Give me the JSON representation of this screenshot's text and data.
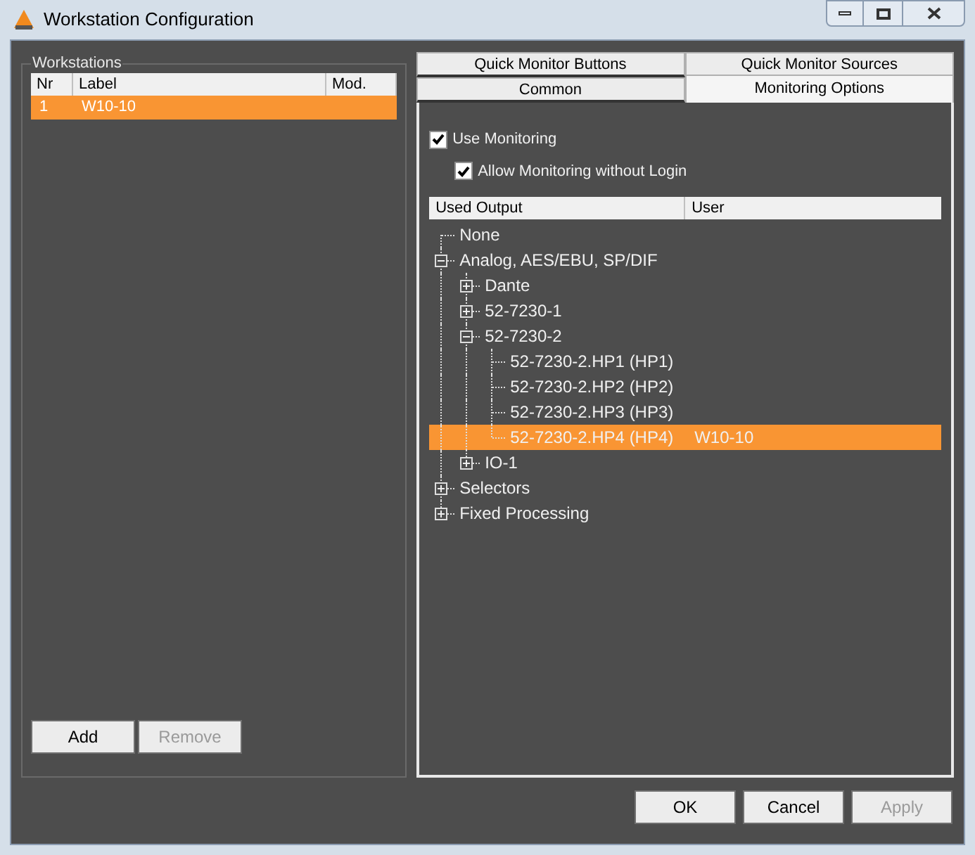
{
  "window": {
    "title": "Workstation Configuration"
  },
  "workstations": {
    "title": "Workstations",
    "columns": [
      "Nr",
      "Label",
      "Mod."
    ],
    "rows": [
      {
        "cells": [
          "1",
          "W10-10",
          ""
        ],
        "selected": true
      }
    ],
    "buttons": [
      {
        "label": "Add",
        "disabled": false
      },
      {
        "label": "Remove",
        "disabled": true
      }
    ]
  },
  "tab_rows": [
    [
      {
        "label": "Quick Monitor Buttons",
        "selected": false
      },
      {
        "label": "Quick Monitor Sources",
        "selected": false
      }
    ],
    [
      {
        "label": "Common",
        "selected": false
      },
      {
        "label": "Monitoring Options",
        "selected": true
      }
    ]
  ],
  "options": [
    {
      "label": "Use Monitoring",
      "checked": true,
      "children": [
        {
          "label": "Allow Monitoring without Login",
          "checked": true
        }
      ]
    }
  ],
  "outputs": {
    "columns": [
      "Used Output",
      "User"
    ],
    "tree": [
      {
        "label": "None",
        "selected": false
      },
      {
        "label": "Analog, AES/EBU, SP/DIF",
        "selected": false,
        "expanded": true,
        "children": [
          {
            "label": "Dante",
            "selected": false,
            "expanded": false
          },
          {
            "label": "52-7230-1",
            "selected": false,
            "expanded": false
          },
          {
            "label": "52-7230-2",
            "selected": false,
            "expanded": true,
            "children": [
              {
                "label": "52-7230-2.HP1 (HP1)",
                "selected": false
              },
              {
                "label": "52-7230-2.HP2 (HP2)",
                "selected": false
              },
              {
                "label": "52-7230-2.HP3 (HP3)",
                "selected": false
              },
              {
                "label": "52-7230-2.HP4 (HP4)",
                "user": "W10-10",
                "selected": true
              }
            ]
          },
          {
            "label": "IO-1",
            "selected": false,
            "expanded": false
          }
        ]
      },
      {
        "label": "Selectors",
        "selected": false,
        "expanded": false
      },
      {
        "label": "Fixed Processing",
        "selected": false,
        "expanded": false
      }
    ]
  },
  "dialog_buttons": [
    {
      "label": "OK",
      "disabled": false
    },
    {
      "label": "Cancel",
      "disabled": false
    },
    {
      "label": "Apply",
      "disabled": true
    }
  ]
}
